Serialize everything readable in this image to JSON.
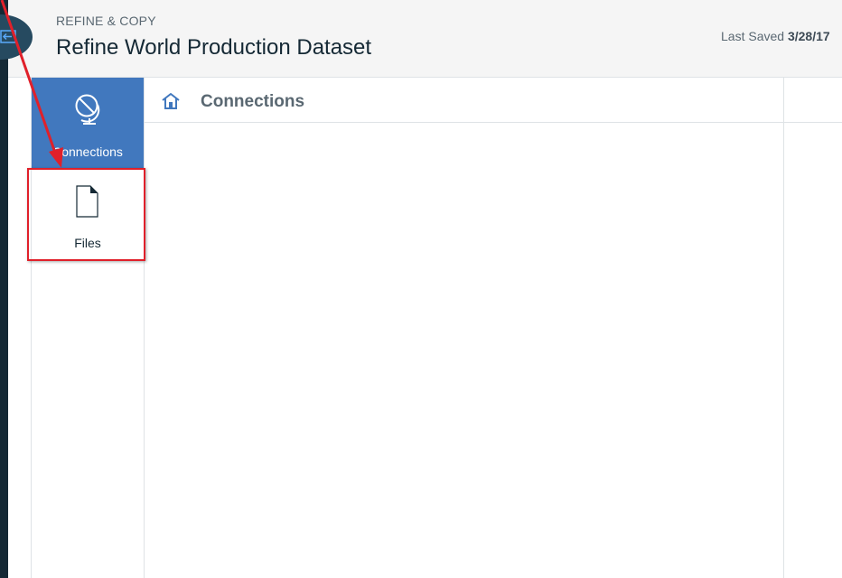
{
  "header": {
    "breadcrumb": "REFINE & COPY",
    "title": "Refine World Production Dataset",
    "last_saved_label": "Last Saved",
    "last_saved_value": "3/28/17"
  },
  "sidenav": {
    "items": [
      {
        "label": "Connections",
        "icon": "globe-icon",
        "active": true
      },
      {
        "label": "Files",
        "icon": "file-icon",
        "active": false
      }
    ]
  },
  "content": {
    "title": "Connections",
    "icon": "home-icon"
  },
  "colors": {
    "accent": "#4178be",
    "dark_strip": "#152935",
    "annotation_red": "#e0202a"
  }
}
